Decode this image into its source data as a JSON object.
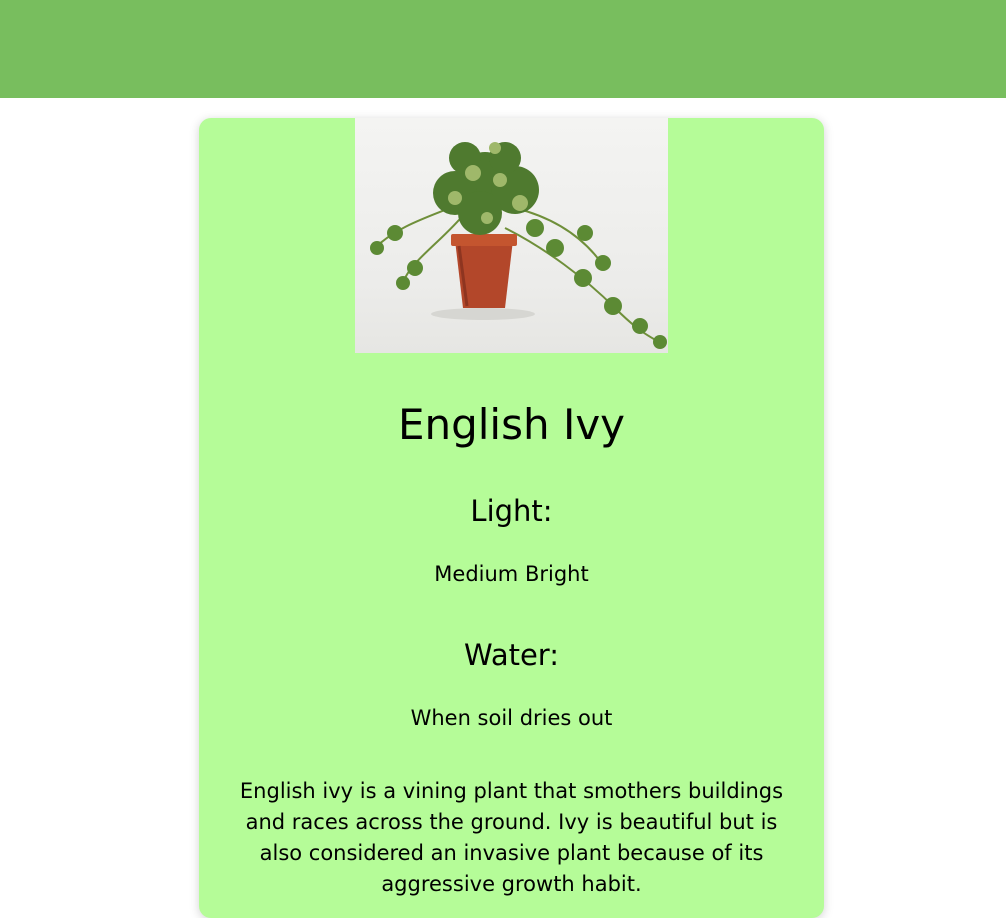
{
  "plant": {
    "name": "English Ivy",
    "light_heading": "Light:",
    "light_value": "Medium Bright",
    "water_heading": "Water:",
    "water_value": "When soil dries out",
    "description": "English ivy is a vining plant that smothers buildings and races across the ground. Ivy is beautiful but is also considered an invasive plant because of its aggressive growth habit."
  },
  "colors": {
    "header": "#78be5e",
    "card": "#b5fc98",
    "pot": "#b3472a",
    "leaf": "#4f7a2f"
  }
}
